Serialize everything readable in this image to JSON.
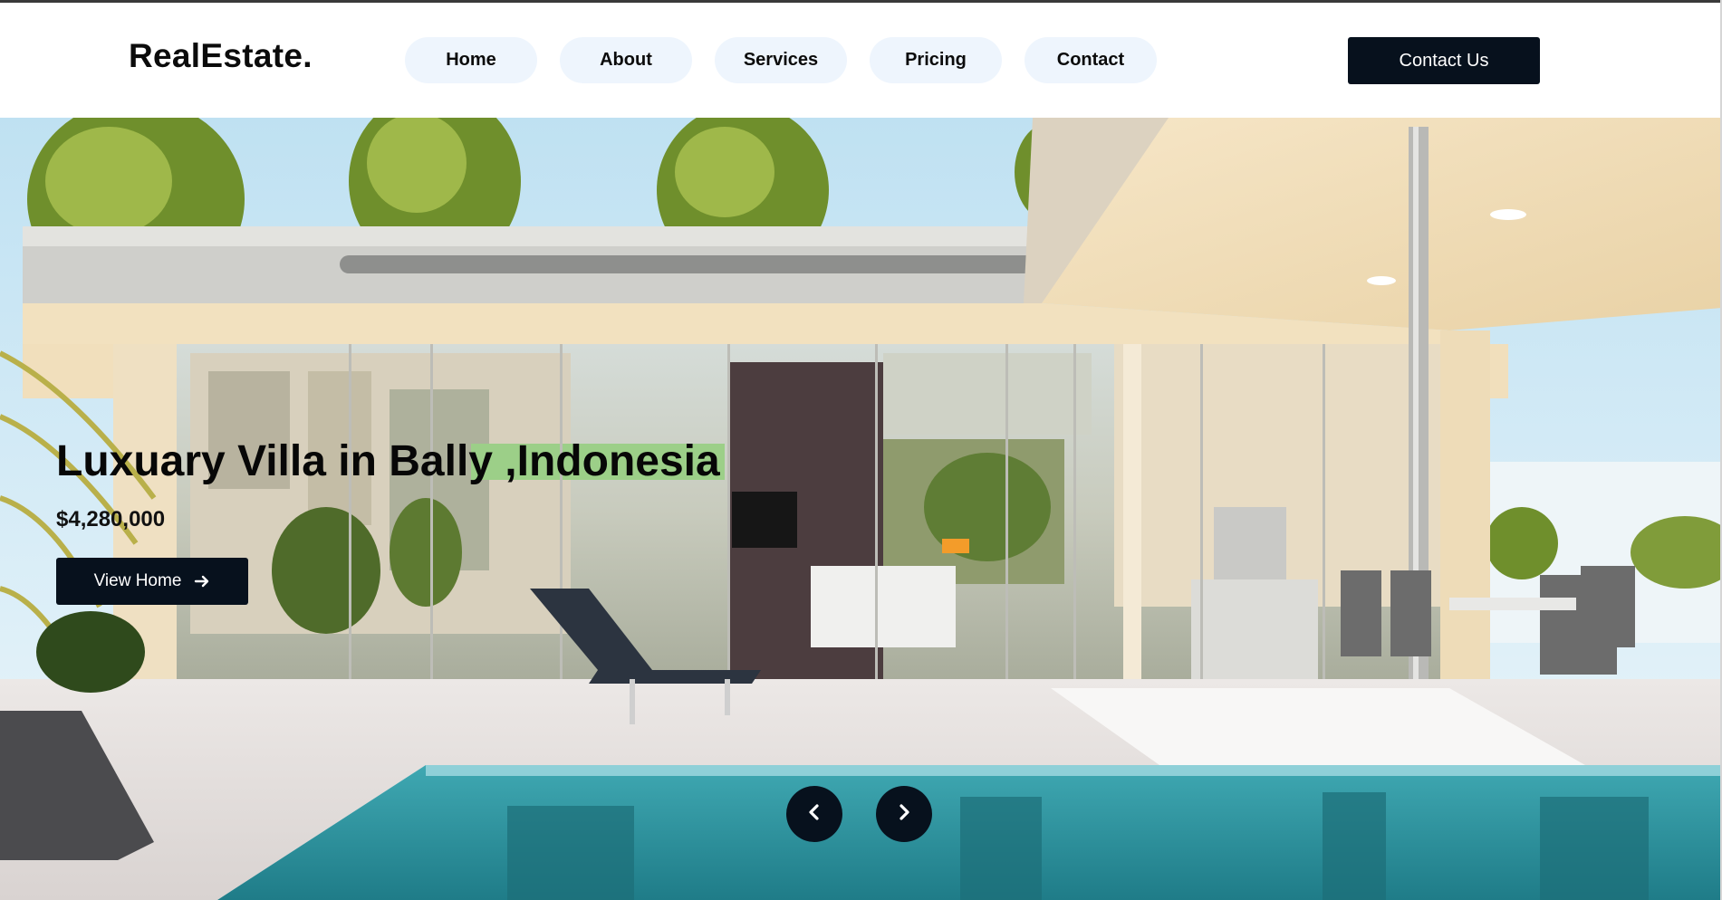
{
  "header": {
    "logo": "RealEstate.",
    "nav": [
      "Home",
      "About",
      "Services",
      "Pricing",
      "Contact"
    ],
    "cta_label": "Contact Us"
  },
  "hero": {
    "title": "Luxuary Villa in Bally ,Indonesia",
    "price": "$4,280,000",
    "button_label": "View Home"
  },
  "colors": {
    "dark": "#07111d",
    "nav_pill": "#eef5fd",
    "pool": "#2f9aa6"
  },
  "icons": {
    "button_arrow": "arrow-right-icon",
    "prev": "chevron-left-icon",
    "next": "chevron-right-icon"
  }
}
